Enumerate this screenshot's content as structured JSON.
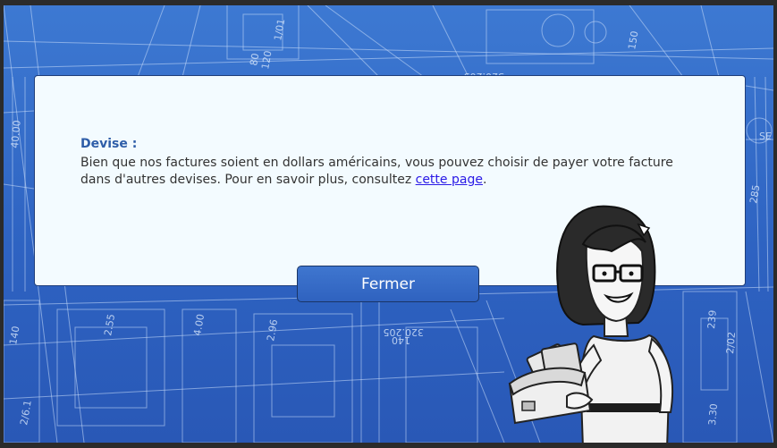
{
  "dialog": {
    "title": "Devise :",
    "text_before": "Bien que nos factures soient en dollars américains, vous pouvez choisir de payer votre facture dans d'autres devises. Pour en savoir plus, consultez ",
    "link_text": "cette page",
    "text_after": "."
  },
  "close_button": {
    "label": "Fermer"
  },
  "blueprint_labels": [
    "1/01",
    "80",
    "120",
    "320.205",
    "150",
    "40.00",
    "285",
    "SE",
    "2/02",
    "239",
    "3.30",
    "320.205",
    "140",
    "2.96",
    "140",
    "2.55",
    "2/6.1",
    "4.00"
  ],
  "colors": {
    "background": "#2e63c2",
    "dialog": "#f3fbff",
    "button": "#3568c6",
    "title": "#2e5da8",
    "link": "#2a1ae6"
  },
  "icons": {
    "character": "woman-with-wallet-illustration"
  }
}
